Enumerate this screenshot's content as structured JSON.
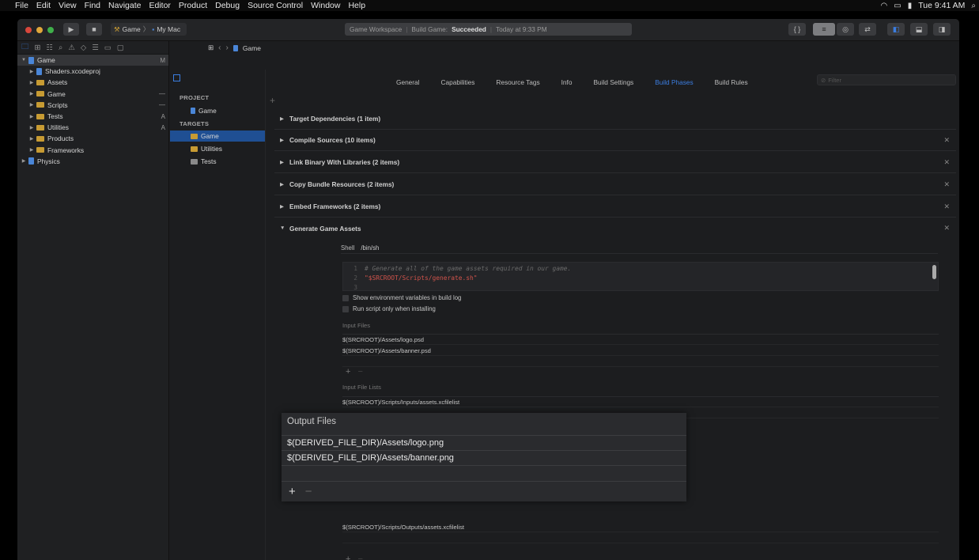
{
  "menubar": {
    "items": [
      "File",
      "Edit",
      "View",
      "Find",
      "Navigate",
      "Editor",
      "Product",
      "Debug",
      "Source Control",
      "Window",
      "Help"
    ],
    "clock": "Tue 9:41 AM"
  },
  "toolbar": {
    "scheme": "Game",
    "destination": "My Mac",
    "activity": {
      "workspace": "Game Workspace",
      "task": "Build Game:",
      "status": "Succeeded",
      "time": "Today at 9:33 PM"
    },
    "editor_buttons": [
      "{ }"
    ]
  },
  "navigator": {
    "items": [
      {
        "label": "Game",
        "badge": "M",
        "level": 0,
        "kind": "doc",
        "expanded": true
      },
      {
        "label": "Shaders.xcodeproj",
        "badge": "",
        "level": 1,
        "kind": "doc"
      },
      {
        "label": "Assets",
        "badge": "",
        "level": 1,
        "kind": "folder"
      },
      {
        "label": "Game",
        "badge": "—",
        "level": 1,
        "kind": "folder"
      },
      {
        "label": "Scripts",
        "badge": "—",
        "level": 1,
        "kind": "folder"
      },
      {
        "label": "Tests",
        "badge": "A",
        "level": 1,
        "kind": "folder"
      },
      {
        "label": "Utilities",
        "badge": "A",
        "level": 1,
        "kind": "folder"
      },
      {
        "label": "Products",
        "badge": "",
        "level": 1,
        "kind": "folder"
      },
      {
        "label": "Frameworks",
        "badge": "",
        "level": 1,
        "kind": "folder"
      },
      {
        "label": "Physics",
        "badge": "",
        "level": 0,
        "kind": "doc"
      }
    ]
  },
  "editor": {
    "jump_bar": "Game",
    "project_heading": "PROJECT",
    "project_item": "Game",
    "targets_heading": "TARGETS",
    "targets": [
      "Game",
      "Utilities",
      "Tests"
    ],
    "tabs": [
      "General",
      "Capabilities",
      "Resource Tags",
      "Info",
      "Build Settings",
      "Build Phases",
      "Build Rules"
    ],
    "selected_tab": "Build Phases",
    "filter_placeholder": "Filter",
    "phases": [
      "Target Dependencies (1 item)",
      "Compile Sources (10 items)",
      "Link Binary With Libraries (2 items)",
      "Copy Bundle Resources (2 items)",
      "Embed Frameworks (2 items)",
      "Generate Game Assets"
    ],
    "shell_label": "Shell",
    "shell_value": "/bin/sh",
    "script_lines": [
      "# Generate all of the game assets required in our game.",
      "\"$SRCROOT/Scripts/generate.sh\"",
      ""
    ],
    "options": [
      "Show environment variables in build log",
      "Run script only when installing"
    ],
    "input_files_label": "Input Files",
    "input_files": [
      "$(SRCROOT)/Assets/logo.psd",
      "$(SRCROOT)/Assets/banner.psd"
    ],
    "input_file_lists_label": "Input File Lists",
    "input_file_lists": [
      "$(SRCROOT)/Scripts/Inputs/assets.xcfilelist"
    ],
    "output_file_lists": [
      "$(SRCROOT)/Scripts/Outputs/assets.xcfilelist"
    ]
  },
  "zoom_panel": {
    "title": "Output Files",
    "files": [
      "$(DERIVED_FILE_DIR)/Assets/logo.png",
      "$(DERIVED_FILE_DIR)/Assets/banner.png"
    ]
  },
  "colors": {
    "accent": "#3b7de0",
    "selection": "#1f4f93",
    "string": "#d0534b",
    "folder": "#c79b33"
  }
}
